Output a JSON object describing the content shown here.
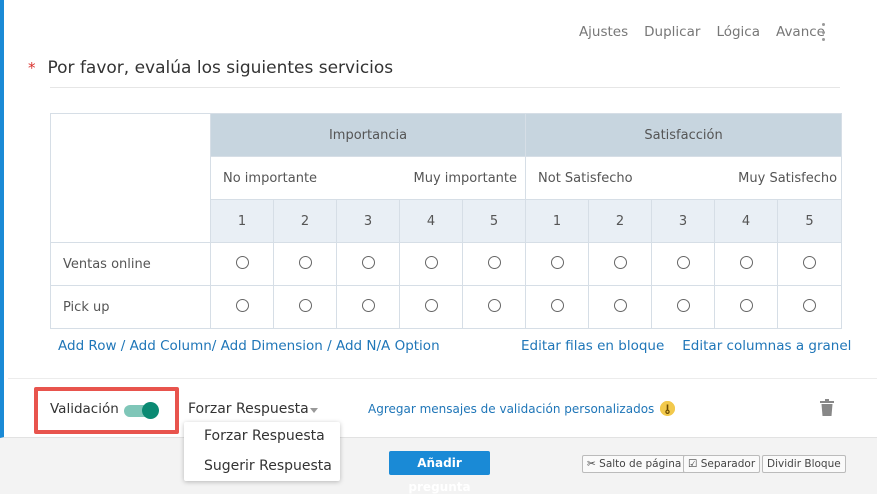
{
  "toolbar": {
    "items": [
      "Ajustes",
      "Duplicar",
      "Lógica",
      "Avance"
    ]
  },
  "question": {
    "required_mark": "*",
    "title": "Por favor, evalúa los siguientes servicios"
  },
  "matrix": {
    "dimensions": [
      {
        "title": "Importancia",
        "low": "No importante",
        "high": "Muy importante",
        "scale": [
          "1",
          "2",
          "3",
          "4",
          "5"
        ]
      },
      {
        "title": "Satisfacción",
        "low": "Not Satisfecho",
        "high": "Muy Satisfecho",
        "scale": [
          "1",
          "2",
          "3",
          "4",
          "5"
        ]
      }
    ],
    "rows": [
      "Ventas online",
      "Pick up"
    ]
  },
  "links": {
    "add_row": "Add Row",
    "sep1": " / ",
    "add_column": "Add Column/",
    "add_dimension": "Add Dimension",
    "sep2": " / ",
    "add_na": "Add N/A Option",
    "edit_rows": "Editar filas en bloque",
    "edit_columns": "Editar columnas a granel"
  },
  "validation": {
    "label": "Validación",
    "enabled": true,
    "selected": "Forzar Respuesta",
    "options": [
      "Forzar Respuesta",
      "Sugerir Respuesta"
    ],
    "custom_link": "Agregar mensajes de validación personalizados"
  },
  "footer": {
    "add_question": "Añadir pregunta",
    "page_break": "Salto de página",
    "separator": "Separador",
    "split_block": "Dividir Bloque"
  },
  "colors": {
    "accent": "#1a8ad6",
    "toggle": "#0b8a73",
    "highlight": "#e8544d",
    "header_bg": "#c7d5df"
  }
}
